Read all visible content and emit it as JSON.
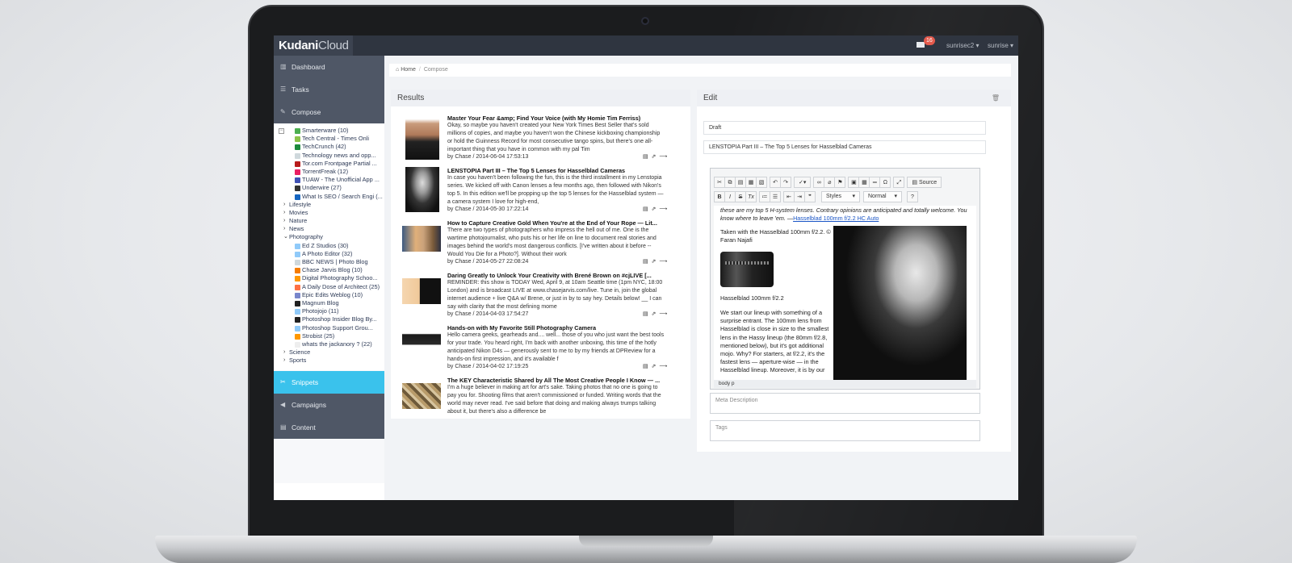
{
  "app": {
    "brand_bold": "Kudani",
    "brand_light": "Cloud",
    "notifications": "16",
    "user_menu_1": "sunrisec2 ▾",
    "user_menu_2": "sunrise ▾"
  },
  "sidebar": {
    "nav_top": [
      {
        "label": "Dashboard",
        "icon": "dashboard-icon",
        "glyph": "▥"
      },
      {
        "label": "Tasks",
        "icon": "tasks-icon",
        "glyph": "☰"
      },
      {
        "label": "Compose",
        "icon": "pencil-icon",
        "glyph": "✎"
      }
    ],
    "nav_bottom": [
      {
        "label": "Snippets",
        "icon": "scissors-icon",
        "glyph": "✂"
      },
      {
        "label": "Campaigns",
        "icon": "bullhorn-icon",
        "glyph": "◀"
      },
      {
        "label": "Content",
        "icon": "file-icon",
        "glyph": "▤"
      }
    ],
    "tree": [
      {
        "type": "child",
        "label": "Smarterware (10)",
        "color": "#4caf50"
      },
      {
        "type": "child",
        "label": "Tech Central - Times Onli",
        "color": "#8bc34a"
      },
      {
        "type": "child",
        "label": "TechCrunch (42)",
        "color": "#1b8a3c"
      },
      {
        "type": "child",
        "label": "Technology news and opp...",
        "color": "#cfd8dc"
      },
      {
        "type": "child",
        "label": "Tor.com Frontpage Partial ...",
        "color": "#b71c1c"
      },
      {
        "type": "child",
        "label": "TorrentFreak (12)",
        "color": "#e91e63"
      },
      {
        "type": "child",
        "label": "TUAW - The Unofficial App ...",
        "color": "#3f51b5"
      },
      {
        "type": "child",
        "label": "Underwire (27)",
        "color": "#333333"
      },
      {
        "type": "child",
        "label": "What Is SEO / Search Engi (...",
        "color": "#1565c0"
      },
      {
        "type": "folder",
        "label": "Lifestyle",
        "chev": "›"
      },
      {
        "type": "folder",
        "label": "Movies",
        "chev": "›"
      },
      {
        "type": "folder",
        "label": "Nature",
        "chev": "›"
      },
      {
        "type": "folder",
        "label": "News",
        "chev": "›"
      },
      {
        "type": "folder",
        "label": "Photography",
        "chev": "⌄"
      },
      {
        "type": "child",
        "label": "Ed Z Studios (30)",
        "color": "#90caf9"
      },
      {
        "type": "child",
        "label": "A Photo Editor (32)",
        "color": "#90caf9"
      },
      {
        "type": "child",
        "label": "BBC NEWS | Photo Blog",
        "color": "#cfd8dc"
      },
      {
        "type": "child",
        "label": "Chase Jarvis Blog (10)",
        "color": "#f57c00"
      },
      {
        "type": "child",
        "label": "Digital Photography Schoo...",
        "color": "#ff9800"
      },
      {
        "type": "child",
        "label": "A Daily Dose of Architect (25)",
        "color": "#ff7043"
      },
      {
        "type": "child",
        "label": "Epic Edits Weblog (10)",
        "color": "#7986cb"
      },
      {
        "type": "child",
        "label": "Magnum Blog",
        "color": "#212121"
      },
      {
        "type": "child",
        "label": "Photojojo (11)",
        "color": "#90caf9"
      },
      {
        "type": "child",
        "label": "Photoshop Insider Blog By...",
        "color": "#212121"
      },
      {
        "type": "child",
        "label": "Photoshop Support Grou...",
        "color": "#90caf9"
      },
      {
        "type": "child",
        "label": "Strobist (25)",
        "color": "#ff9800"
      },
      {
        "type": "child",
        "label": "whats the jackanory ? (22)",
        "color": "#eeeeee"
      },
      {
        "type": "folder",
        "label": "Science",
        "chev": "›"
      },
      {
        "type": "folder",
        "label": "Sports",
        "chev": "›"
      }
    ]
  },
  "breadcrumb": {
    "home": "Home",
    "sep": "/",
    "current": "Compose"
  },
  "results": {
    "title": "Results",
    "items": [
      {
        "title": "Master Your Fear &amp; Find Your Voice (with My Homie Tim Ferriss)",
        "body": "Okay, so maybe you haven't created your New York Times Best Seller that's sold millions of copies, and maybe you haven't won the Chinese kickboxing championship or hold the Guinness Record for most consecutive tango spins, but there's one all-important thing that you have in common with my pal Tim",
        "meta": "by Chase / 2014-06-04 17:53:13"
      },
      {
        "title": "LENSTOPIA Part III – The Top 5 Lenses for Hasselblad Cameras",
        "body": "In case you haven't been following the fun, this is the third installment in my Lenstopia series. We kicked off with Canon lenses a few months ago, then followed with Nikon's top 5. In this edition we'll be propping up the top 5 lenses for the Hasselblad system — a camera system I love for high-end,",
        "meta": "by Chase / 2014-05-30 17:22:14"
      },
      {
        "title": "How to Capture Creative Gold When You're at the End of Your Rope — Lit...",
        "body": "There are two types of photographers who impress the hell out of me. One is the wartime photojournalist, who puts his or her life on line to document real stories and images behind the world's most dangerous conflicts. [I've written about it before -- Would You Die for a Photo?]. Without their work",
        "meta": "by Chase / 2014-05-27 22:08:24"
      },
      {
        "title": "Daring Greatly to Unlock Your Creativity with Brené Brown on #cjLIVE [...",
        "body": "REMINDER: this show is TODAY Wed, April 9, at 10am Seattle time (1pm NYC, 18:00 London) and is broadcast LIVE at www.chasejarvis.com/live. Tune in, join the global internet audience + live Q&A w/ Brene, or just in by to say hey. Details below! __ I can say with clarity that the most defining mome",
        "meta": "by Chase / 2014-04-03 17:54:27"
      },
      {
        "title": "Hands-on with My Favorite Still Photography Camera",
        "body": "Hello camera geeks, gearheads and.... well... those of you who just want the best tools for your trade. You heard right, I'm back with another unboxing, this time of the hotly anticipated Nikon D4s — generously sent to me to by my friends at DPReview for a hands-on first impression, and it's available f",
        "meta": "by Chase / 2014-04-02 17:19:25"
      },
      {
        "title": "The KEY Characteristic Shared by All The Most Creative People I Know — ...",
        "body": "I'm a huge believer in making art for art's sake. Taking photos that no one is going to pay you for. Shooting films that aren't commissioned or funded. Writing words that the world may never read. I've said before that doing and making always trumps talking about it, but there's also a difference be",
        "meta": ""
      }
    ],
    "actions": "▤ ⇗ ⟶"
  },
  "edit": {
    "title": "Edit",
    "status_value": "Draft",
    "title_value": "LENSTOPIA Part III – The Top 5 Lenses for Hasselblad Cameras",
    "toolbar": {
      "source_label": "Source",
      "styles_label": "Styles",
      "format_label": "Normal",
      "help_label": "?",
      "bold": "B",
      "italic": "I",
      "strike": "S",
      "clear": "Tx"
    },
    "content": {
      "intro": "these are my top 5 H-system lenses. Contrary opinions are anticipated and totally welcome. You know where to leave 'em. —",
      "link": "Hasselblad 100mm f/2.2 HC Auto",
      "caption": "Taken with the Hasselblad 100mm f/2.2. © Faran Najafi",
      "lens_label": "Hasselblad 100mm f/2.2",
      "para": "We start our lineup with something of a surprise entrant. The 100mm lens from Hasselblad is close in size to the smallest lens in the Hassy lineup (the 80mm f/2.8, mentioned below), but it's got additional mojo. Why? For starters, at f/2.2, it's the fastest lens — aperture-wise — in the Hasselblad lineup. Moreover, it is by our"
    },
    "status_path": "body  p",
    "meta_placeholder": "Meta Description",
    "tags_placeholder": "Tags"
  }
}
